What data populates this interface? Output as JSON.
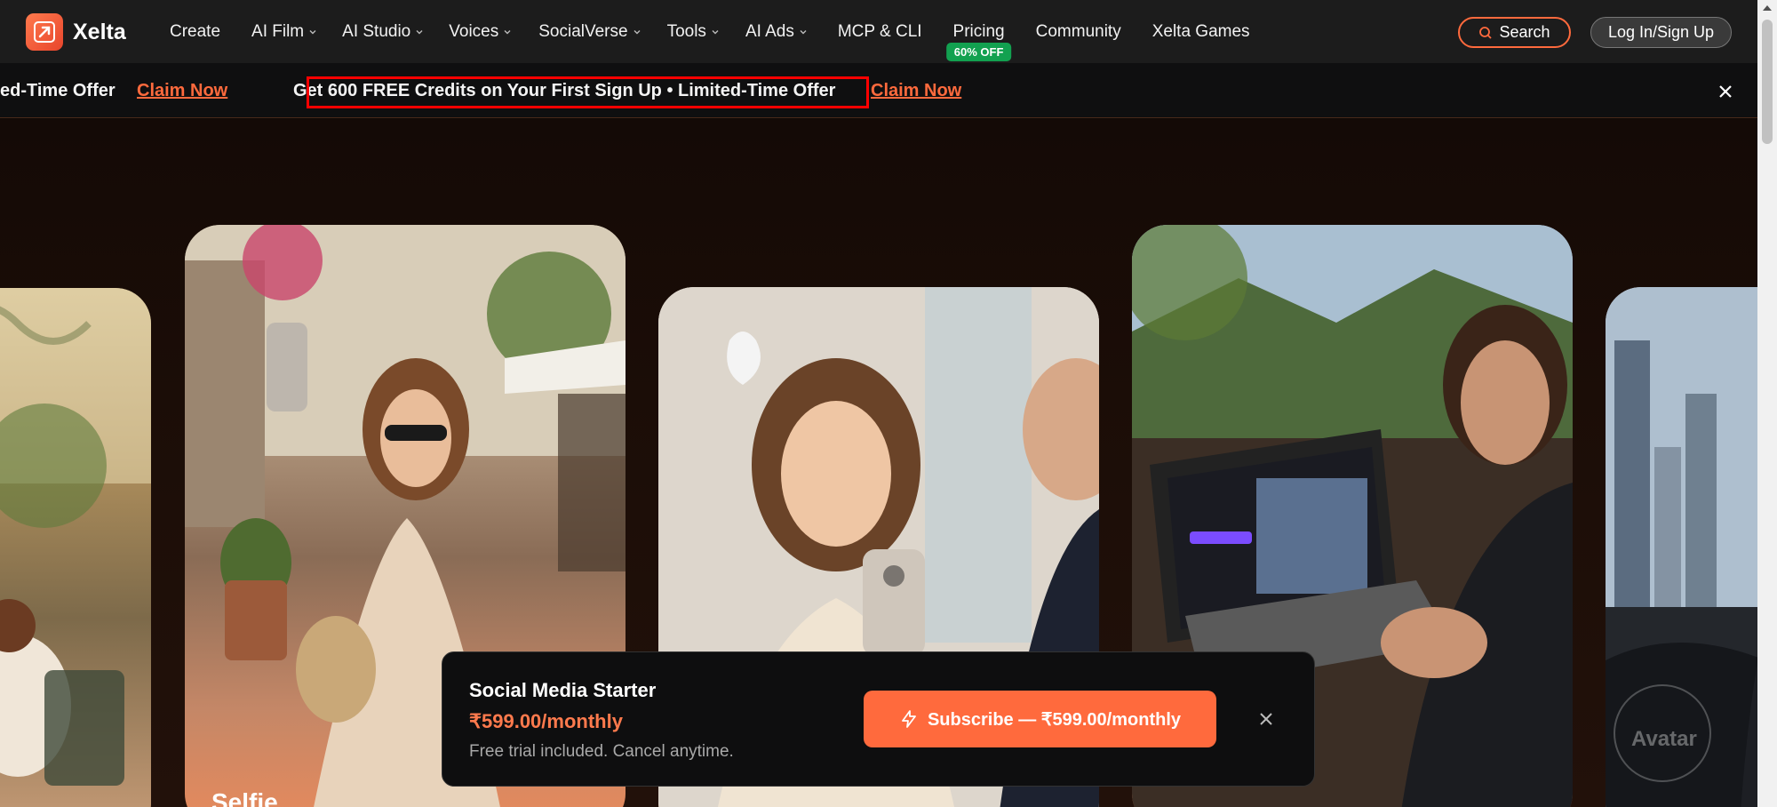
{
  "brand": {
    "name": "Xelta"
  },
  "nav": {
    "items": [
      {
        "label": "Create",
        "dropdown": false
      },
      {
        "label": "AI Film",
        "dropdown": true
      },
      {
        "label": "AI Studio",
        "dropdown": true
      },
      {
        "label": "Voices",
        "dropdown": true
      },
      {
        "label": "SocialVerse",
        "dropdown": true
      },
      {
        "label": "Tools",
        "dropdown": true
      },
      {
        "label": "AI Ads",
        "dropdown": true
      },
      {
        "label": "MCP & CLI",
        "dropdown": false
      },
      {
        "label": "Pricing",
        "dropdown": false,
        "badge": "60% OFF"
      },
      {
        "label": "Community",
        "dropdown": false
      },
      {
        "label": "Xelta Games",
        "dropdown": false
      }
    ],
    "search_label": "Search",
    "login_label": "Log In/Sign Up"
  },
  "announcement": {
    "partial_text": "ed-Time Offer",
    "claim_label": "Claim Now",
    "text": "Get 600 FREE Credits on Your First Sign Up • Limited-Time Offer",
    "claim_label_2": "Claim Now"
  },
  "hero": {
    "cards": [
      {
        "label": ""
      },
      {
        "label": "Selfie"
      },
      {
        "label": ""
      },
      {
        "label": ""
      },
      {
        "label": "Avatar"
      }
    ]
  },
  "popup": {
    "title": "Social Media Starter",
    "price": "₹599.00/monthly",
    "subtitle": "Free trial included. Cancel anytime.",
    "button_label": "Subscribe — ₹599.00/monthly"
  },
  "colors": {
    "accent": "#ff6a3d",
    "badge": "#12a150",
    "nav_bg": "#1c1c1c",
    "highlight": "#ff0000"
  }
}
